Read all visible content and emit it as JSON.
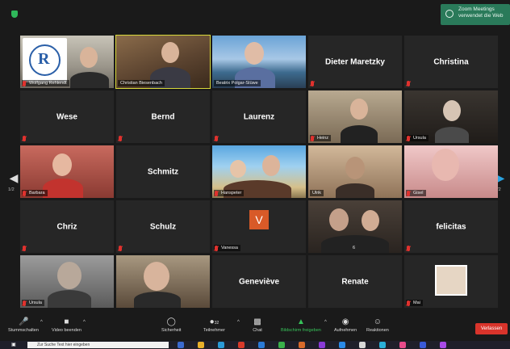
{
  "notification": {
    "line1": "Zoom Meetings",
    "line2": "verwendet die Web"
  },
  "pager": {
    "left": "1/2",
    "right": "1/2"
  },
  "tiles": [
    {
      "type": "logo",
      "label": "Wolfgang Rehlendt",
      "muted": true
    },
    {
      "type": "video",
      "label": "Christian Biesenbach",
      "muted": false,
      "active": true
    },
    {
      "type": "harbor",
      "label": "Beatrix Polgar-Stüwe",
      "muted": false
    },
    {
      "type": "name",
      "name": "Dieter Maretzky",
      "muted": true
    },
    {
      "type": "name",
      "name": "Christina",
      "muted": true
    },
    {
      "type": "name",
      "name": "Wese",
      "muted": true
    },
    {
      "type": "name",
      "name": "Bernd",
      "muted": true
    },
    {
      "type": "name",
      "name": "Laurenz",
      "muted": true
    },
    {
      "type": "video",
      "label": "Heinz",
      "muted": true
    },
    {
      "type": "video",
      "label": "Ursula",
      "muted": true
    },
    {
      "type": "video",
      "label": "Barbara",
      "muted": true
    },
    {
      "type": "name",
      "name": "Schmitz",
      "muted": false
    },
    {
      "type": "video",
      "label": "Hanspeter",
      "muted": true
    },
    {
      "type": "video",
      "label": "Ulrik",
      "muted": false
    },
    {
      "type": "video",
      "label": "Gisel",
      "muted": true
    },
    {
      "type": "name",
      "name": "Chriz",
      "muted": true
    },
    {
      "type": "name",
      "name": "Schulz",
      "muted": true
    },
    {
      "type": "v",
      "letter": "V",
      "label": "Vanessa",
      "muted": true
    },
    {
      "type": "video",
      "label": "6",
      "muted": false
    },
    {
      "type": "name",
      "name": "felicitas",
      "muted": true
    },
    {
      "type": "video",
      "label": "Ursula",
      "muted": true
    },
    {
      "type": "video",
      "label": "",
      "muted": false
    },
    {
      "type": "name",
      "name": "Geneviève",
      "muted": false
    },
    {
      "type": "name",
      "name": "Renate",
      "muted": false
    },
    {
      "type": "thumb",
      "label": "Mai",
      "muted": true
    }
  ],
  "toolbar": {
    "mute": "Stummschalten",
    "video": "Video beenden",
    "security": "Sicherheit",
    "participants": "Teilnehmer",
    "participants_count": "32",
    "chat": "Chat",
    "share": "Bildschirm freigeben",
    "record": "Aufnehmen",
    "reactions": "Reaktionen",
    "leave": "Verlassen"
  },
  "taskbar": {
    "search_placeholder": "Zur Suche Text hier eingeben"
  },
  "colors": {
    "accent_green": "#37c45a",
    "leave_red": "#d9342b",
    "active_border": "#d7d83a"
  }
}
